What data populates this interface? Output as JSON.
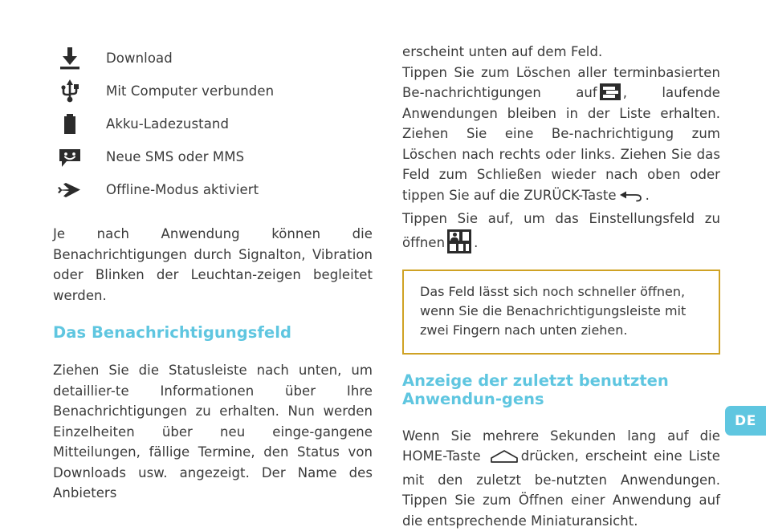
{
  "status_icons": {
    "items": [
      {
        "icon": "download-icon",
        "label": "Download"
      },
      {
        "icon": "usb-icon",
        "label": "Mit Computer verbunden"
      },
      {
        "icon": "battery-icon",
        "label": "Akku-Ladezustand"
      },
      {
        "icon": "message-icon",
        "label": "Neue SMS oder MMS"
      },
      {
        "icon": "airplane-mode-icon",
        "label": "Offline-Modus aktiviert"
      }
    ]
  },
  "left_column": {
    "paragraph_1": "Je nach Anwendung können die Benachrichtigungen durch Signalton, Vibration oder Blinken der Leuchtan-zeigen begleitet werden.",
    "heading": "Das Benachrichtigungsfeld",
    "paragraph_2": "Ziehen Sie die Statusleiste nach unten, um detaillier-te Informationen über Ihre Benachrichtigungen zu erhalten. Nun werden Einzelheiten über neu einge-gangene Mitteilungen, fällige Termine, den Status von Downloads usw. angezeigt. Der Name des Anbieters"
  },
  "right_column": {
    "line_1": "erscheint unten auf dem Feld.",
    "para_2_part_1": "Tippen Sie zum Löschen aller terminbasierten Be-nachrichtigungen auf",
    "para_2_part_2": ", laufende Anwendungen bleiben in der Liste erhalten. Ziehen Sie eine Be-nachrichtigung zum Löschen nach rechts oder links. Ziehen Sie das Feld zum Schließen wieder nach oben oder tippen Sie auf die ZURÜCK-Taste",
    "para_2_part_3": ".",
    "para_3_part_1": "Tippen Sie auf, um das Einstellungsfeld zu öffnen",
    "para_3_part_2": ".",
    "inline_icons": {
      "clear_notifications": "clear-notifications-icon",
      "back_button": "back-arrow-icon",
      "settings_grid": "settings-grid-icon",
      "home_button": "home-button-icon"
    },
    "note": {
      "text": "Das Feld lässt sich noch schneller öffnen, wenn Sie die Benachrichtigungsleiste mit zwei Fingern nach unten ziehen.",
      "border_color": "#cfa224"
    },
    "heading": "Anzeige der zuletzt benutzten Anwendun-gens",
    "paragraph_final_part_1": "Wenn Sie mehrere Sekunden lang auf die HOME-Taste",
    "paragraph_final_part_2": "drücken, erscheint eine Liste mit den zuletzt be-nutzten Anwendungen. Tippen Sie zum Öffnen einer Anwendung auf die entsprechende Miniaturansicht."
  },
  "language_badge": {
    "label": "DE",
    "color": "#5fc6e0"
  },
  "theme": {
    "accent": "#5fc6e0",
    "text": "#3a3a3a",
    "note_border": "#cfa224",
    "icon_dark": "#2b2b2b"
  }
}
